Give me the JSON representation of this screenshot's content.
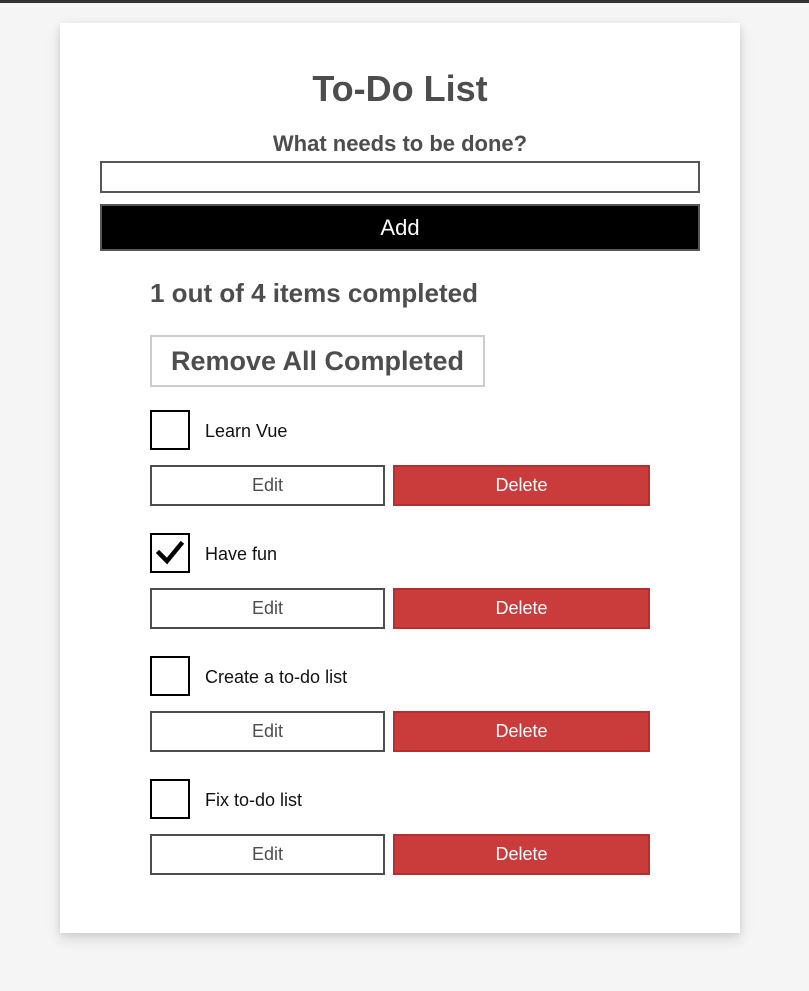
{
  "app": {
    "title": "To-Do List"
  },
  "form": {
    "label": "What needs to be done?",
    "input_value": "",
    "input_placeholder": "",
    "add_label": "Add"
  },
  "summary": {
    "text": "1 out of 4 items completed",
    "completed": 1,
    "total": 4
  },
  "actions": {
    "remove_completed_label": "Remove All Completed"
  },
  "todos": [
    {
      "label": "Learn Vue",
      "done": false,
      "edit_label": "Edit",
      "delete_label": "Delete"
    },
    {
      "label": "Have fun",
      "done": true,
      "edit_label": "Edit",
      "delete_label": "Delete"
    },
    {
      "label": "Create a to-do list",
      "done": false,
      "edit_label": "Edit",
      "delete_label": "Delete"
    },
    {
      "label": "Fix to-do list",
      "done": false,
      "edit_label": "Edit",
      "delete_label": "Delete"
    }
  ],
  "icons": {
    "check": "checkmark-icon"
  },
  "colors": {
    "delete_bg": "#ca3c3c",
    "add_bg": "#000000",
    "text_gray": "#4d4d4d"
  }
}
